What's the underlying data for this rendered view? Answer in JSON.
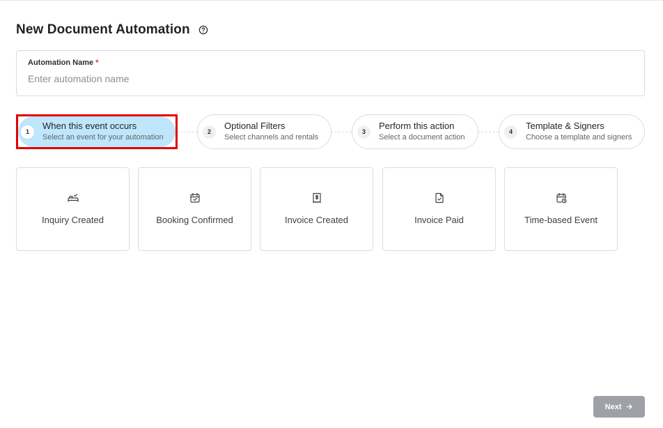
{
  "page": {
    "title": "New Document Automation"
  },
  "automation_name": {
    "label": "Automation Name",
    "required_mark": "*",
    "value": "",
    "placeholder": "Enter automation name"
  },
  "steps": [
    {
      "number": "1",
      "title": "When this event occurs",
      "subtitle": "Select an event for your automation",
      "active": true
    },
    {
      "number": "2",
      "title": "Optional Filters",
      "subtitle": "Select channels and rentals",
      "active": false
    },
    {
      "number": "3",
      "title": "Perform this action",
      "subtitle": "Select a document action",
      "active": false
    },
    {
      "number": "4",
      "title": "Template & Signers",
      "subtitle": "Choose a template and signers",
      "active": false
    }
  ],
  "events": [
    {
      "label": "Inquiry Created",
      "icon": "bed-check-icon"
    },
    {
      "label": "Booking Confirmed",
      "icon": "calendar-check-icon"
    },
    {
      "label": "Invoice Created",
      "icon": "receipt-dollar-icon"
    },
    {
      "label": "Invoice Paid",
      "icon": "document-check-icon"
    },
    {
      "label": "Time-based Event",
      "icon": "calendar-clock-icon"
    }
  ],
  "footer": {
    "next_label": "Next",
    "next_icon": "arrow-right-icon"
  },
  "colors": {
    "active_step_bg": "#bfe6fb",
    "highlight_border": "#e00000",
    "disabled_button": "#9ea2a7",
    "required": "#d93025"
  }
}
